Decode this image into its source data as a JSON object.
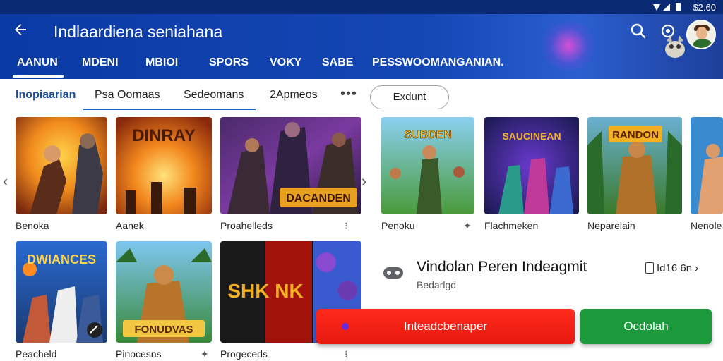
{
  "status": {
    "time": "$2.60"
  },
  "header": {
    "title": "Indlaardiena seniahana",
    "back_icon": "arrow-left-icon",
    "search_icon": "search-icon",
    "settings_icon": "cast-icon"
  },
  "categories": [
    {
      "label": "AANUN",
      "active": true
    },
    {
      "label": "MDENI",
      "active": false
    },
    {
      "label": "MBIOI",
      "active": false
    },
    {
      "label": "SPORS",
      "active": false
    },
    {
      "label": "VOKY",
      "active": false
    },
    {
      "label": "SABE",
      "active": false
    },
    {
      "label": "PESSWOOMANGANIAN.",
      "active": false
    }
  ],
  "subtabs": [
    {
      "label": "Inopiaarian",
      "active": true
    },
    {
      "label": "Psa Oomaas",
      "active": false
    },
    {
      "label": "Sedeomans",
      "active": false
    },
    {
      "label": "2Apmeos",
      "active": false
    }
  ],
  "subtabs_more": "•••",
  "filter_pill": "Exdunt",
  "left_games": {
    "row1": [
      {
        "name": "Benoka",
        "art_text": ""
      },
      {
        "name": "Aanek",
        "art_text": "DINRAY"
      },
      {
        "name": "Proahelleds",
        "art_text": "DACANDEN"
      }
    ],
    "row2": [
      {
        "name": "Peacheld",
        "art_text": "DWIANCES"
      },
      {
        "name": "Pinocesns",
        "art_text": "FONUDVAS"
      },
      {
        "name": "Progeceds",
        "art_text": "SHK NK"
      }
    ]
  },
  "right_games": [
    {
      "name": "Penoku",
      "art_text": "SUBDEN"
    },
    {
      "name": "Flachmeken",
      "art_text": "SAUCINEAN"
    },
    {
      "name": "Neparelain",
      "art_text": "RANDON"
    },
    {
      "name": "Nenole",
      "art_text": ""
    }
  ],
  "installed": {
    "title": "Vindolan Peren Indeagmit",
    "subtitle": "Bedarlgd",
    "size": "Id16 6n"
  },
  "actions": {
    "primary": "Inteadcbenaper",
    "secondary": "Ocdolah"
  },
  "colors": {
    "header": "#0a3aa3",
    "primary_button": "#f2251b",
    "secondary_button": "#1b9a3c",
    "active_subtab": "#1b4fa0"
  }
}
